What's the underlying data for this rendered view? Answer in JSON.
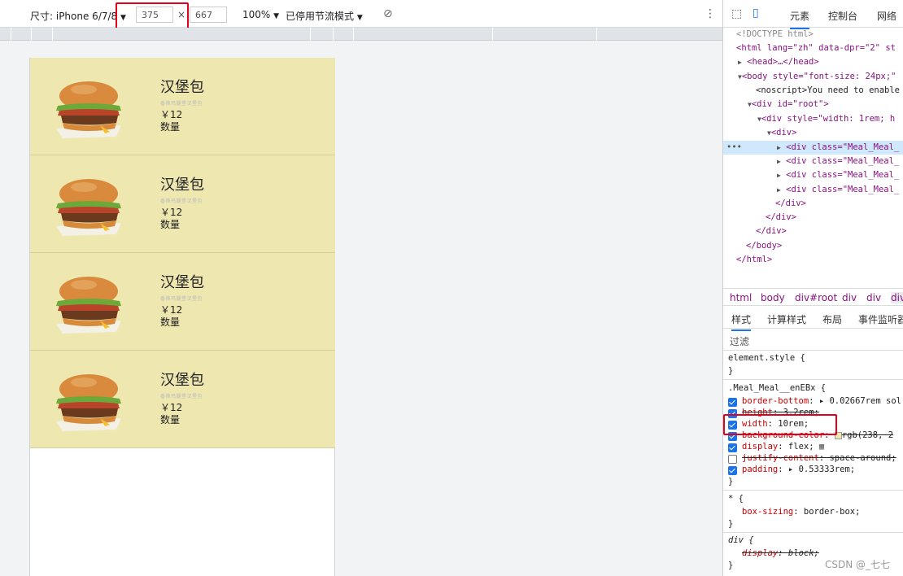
{
  "device_toolbar": {
    "dimensions_label": "尺寸: iPhone 6/7/8",
    "width_value": "375",
    "times": "×",
    "height_value": "667",
    "zoom": "100%",
    "throttle": "已停用节流模式"
  },
  "meals": [
    {
      "name": "汉堡包",
      "desc": "香辣鸡腿堡汉堡包",
      "price": "￥12",
      "qty": "数量"
    },
    {
      "name": "汉堡包",
      "desc": "香辣鸡腿堡汉堡包",
      "price": "￥12",
      "qty": "数量"
    },
    {
      "name": "汉堡包",
      "desc": "香辣鸡腿堡汉堡包",
      "price": "￥12",
      "qty": "数量"
    },
    {
      "name": "汉堡包",
      "desc": "香辣鸡腿堡汉堡包",
      "price": "￥12",
      "qty": "数量"
    }
  ],
  "devtools": {
    "tabs": [
      "元素",
      "控制台",
      "网络"
    ],
    "dom_lines": [
      "<!DOCTYPE html>",
      "<html lang=\"zh\" data-dpr=\"2\" st",
      "<head>…</head>",
      "<body style=\"font-size: 24px;\"",
      "<noscript>You need to enable",
      "<div id=\"root\">",
      "<div style=\"width: 1rem; h",
      "<div>",
      "<div class=\"Meal_Meal_",
      "<div class=\"Meal_Meal_",
      "<div class=\"Meal_Meal_",
      "<div class=\"Meal_Meal_",
      "</div>",
      "</div>",
      "</div>",
      "</body>",
      "</html>"
    ],
    "breadcrumbs": [
      "html",
      "body",
      "div#root",
      "div",
      "div",
      "div"
    ],
    "style_tabs": [
      "样式",
      "计算样式",
      "布局",
      "事件监听器"
    ],
    "filter_placeholder": "过滤",
    "rules": {
      "element_style": "element.style {",
      "close": "}",
      "meal_selector": ".Meal_Meal__enEBx {",
      "props": [
        {
          "name": "border-bottom",
          "value": "▸ 0.02667rem sol",
          "checked": true,
          "struck": false
        },
        {
          "name": "height",
          "value": "3.2rem;",
          "checked": true,
          "struck": true
        },
        {
          "name": "width",
          "value": "10rem;",
          "checked": true,
          "struck": false
        },
        {
          "name": "background-color",
          "value": "rgb(238, 2",
          "checked": true,
          "struck": true
        },
        {
          "name": "display",
          "value": "flex;",
          "checked": true,
          "struck": false
        },
        {
          "name": "justify-content",
          "value": "space-around;",
          "checked": false,
          "struck": true
        },
        {
          "name": "padding",
          "value": "▸ 0.53333rem;",
          "checked": true,
          "struck": false
        }
      ],
      "universal_selector": "* {",
      "box_sizing_name": "box-sizing",
      "box_sizing_value": "border-box;",
      "div_selector": "div {",
      "display_name": "display",
      "display_value": "block;"
    }
  },
  "watermark": "CSDN @_七七",
  "colors": {
    "meal_bg": "#eee8b0",
    "highlight": "#e3001b",
    "selection": "#cfe8fc"
  }
}
